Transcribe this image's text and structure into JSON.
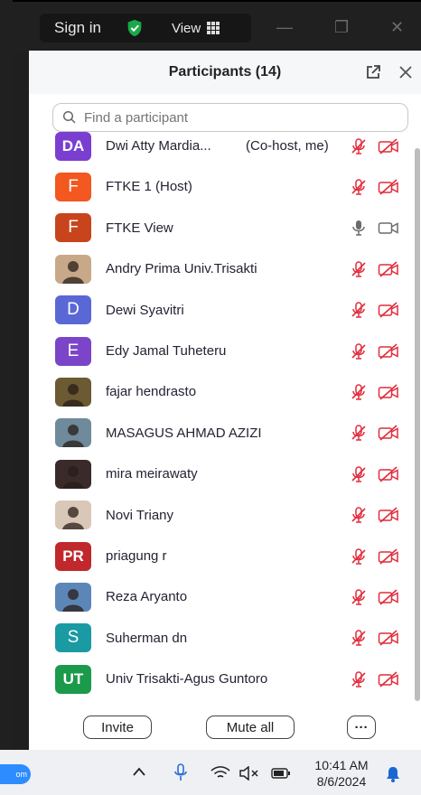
{
  "topbar": {
    "sign_in": "Sign in",
    "view": "View"
  },
  "panel": {
    "title": "Participants (14)",
    "search_placeholder": "Find a participant"
  },
  "participants": [
    {
      "name": "Dwi Atty Mardia...",
      "tag": "(Co-host, me)",
      "initials": "DA",
      "avatar_color": "#7a3fd0",
      "audio": "muted",
      "video": "off"
    },
    {
      "name": "FTKE 1 (Host)",
      "tag": "",
      "initials": "F",
      "avatar_color": "#f2581f",
      "audio": "muted",
      "video": "off"
    },
    {
      "name": "FTKE View",
      "tag": "",
      "initials": "F",
      "avatar_color": "#c8441c",
      "audio": "on",
      "video": "on"
    },
    {
      "name": "Andry Prima Univ.Trisakti",
      "tag": "",
      "initials": "",
      "avatar_color": "#c7a98a",
      "audio": "muted",
      "video": "off"
    },
    {
      "name": "Dewi Syavitri",
      "tag": "",
      "initials": "D",
      "avatar_color": "#5a68d6",
      "audio": "muted",
      "video": "off"
    },
    {
      "name": "Edy Jamal Tuheteru",
      "tag": "",
      "initials": "E",
      "avatar_color": "#7a45c9",
      "audio": "muted",
      "video": "off"
    },
    {
      "name": "fajar hendrasto",
      "tag": "",
      "initials": "",
      "avatar_color": "#6b5a32",
      "audio": "muted",
      "video": "off"
    },
    {
      "name": "MASAGUS AHMAD AZIZI",
      "tag": "",
      "initials": "",
      "avatar_color": "#6f8a9a",
      "audio": "muted",
      "video": "off"
    },
    {
      "name": "mira meirawaty",
      "tag": "",
      "initials": "",
      "avatar_color": "#3b2a2a",
      "audio": "muted",
      "video": "off"
    },
    {
      "name": "Novi Triany",
      "tag": "",
      "initials": "",
      "avatar_color": "#d9c7b8",
      "audio": "muted",
      "video": "off"
    },
    {
      "name": "priagung r",
      "tag": "",
      "initials": "PR",
      "avatar_color": "#c0282c",
      "audio": "muted",
      "video": "off"
    },
    {
      "name": "Reza Aryanto",
      "tag": "",
      "initials": "",
      "avatar_color": "#5d86b8",
      "audio": "muted",
      "video": "off"
    },
    {
      "name": "Suherman dn",
      "tag": "",
      "initials": "S",
      "avatar_color": "#1a9aa3",
      "audio": "muted",
      "video": "off"
    },
    {
      "name": "Univ Trisakti-Agus Guntoro",
      "tag": "",
      "initials": "UT",
      "avatar_color": "#1a9a4a",
      "audio": "muted",
      "video": "off"
    }
  ],
  "footer": {
    "invite": "Invite",
    "mute_all": "Mute all",
    "more": "···"
  },
  "taskbar": {
    "app_label": "om",
    "time": "10:41 AM",
    "date": "8/6/2024"
  },
  "colors": {
    "muted_red": "#e02d3c",
    "accent_blue": "#0e72ed",
    "shield_green": "#19a94a"
  }
}
